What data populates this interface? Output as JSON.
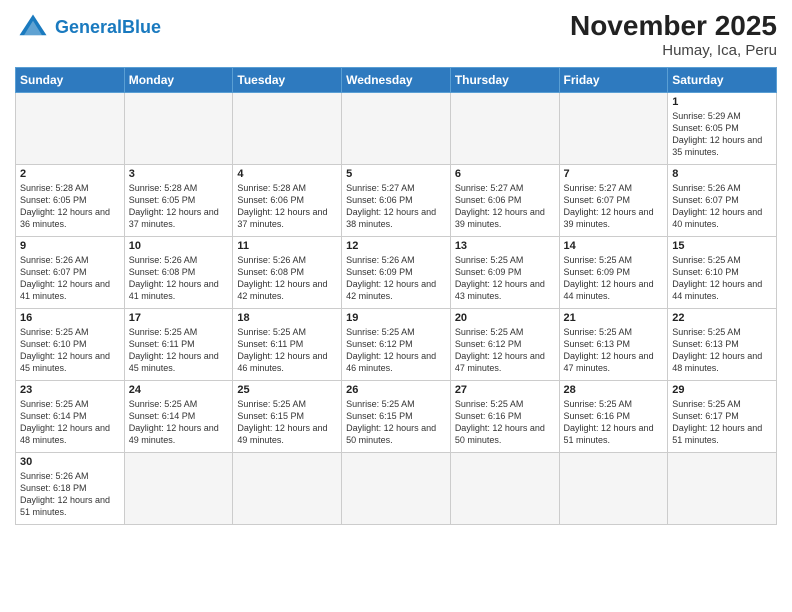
{
  "header": {
    "logo_general": "General",
    "logo_blue": "Blue",
    "title": "November 2025",
    "subtitle": "Humay, Ica, Peru"
  },
  "days_of_week": [
    "Sunday",
    "Monday",
    "Tuesday",
    "Wednesday",
    "Thursday",
    "Friday",
    "Saturday"
  ],
  "weeks": [
    [
      {
        "day": "",
        "info": "",
        "empty": true
      },
      {
        "day": "",
        "info": "",
        "empty": true
      },
      {
        "day": "",
        "info": "",
        "empty": true
      },
      {
        "day": "",
        "info": "",
        "empty": true
      },
      {
        "day": "",
        "info": "",
        "empty": true
      },
      {
        "day": "",
        "info": "",
        "empty": true
      },
      {
        "day": "1",
        "info": "Sunrise: 5:29 AM\nSunset: 6:05 PM\nDaylight: 12 hours\nand 35 minutes."
      }
    ],
    [
      {
        "day": "2",
        "info": "Sunrise: 5:28 AM\nSunset: 6:05 PM\nDaylight: 12 hours\nand 36 minutes."
      },
      {
        "day": "3",
        "info": "Sunrise: 5:28 AM\nSunset: 6:05 PM\nDaylight: 12 hours\nand 37 minutes."
      },
      {
        "day": "4",
        "info": "Sunrise: 5:28 AM\nSunset: 6:06 PM\nDaylight: 12 hours\nand 37 minutes."
      },
      {
        "day": "5",
        "info": "Sunrise: 5:27 AM\nSunset: 6:06 PM\nDaylight: 12 hours\nand 38 minutes."
      },
      {
        "day": "6",
        "info": "Sunrise: 5:27 AM\nSunset: 6:06 PM\nDaylight: 12 hours\nand 39 minutes."
      },
      {
        "day": "7",
        "info": "Sunrise: 5:27 AM\nSunset: 6:07 PM\nDaylight: 12 hours\nand 39 minutes."
      },
      {
        "day": "8",
        "info": "Sunrise: 5:26 AM\nSunset: 6:07 PM\nDaylight: 12 hours\nand 40 minutes."
      }
    ],
    [
      {
        "day": "9",
        "info": "Sunrise: 5:26 AM\nSunset: 6:07 PM\nDaylight: 12 hours\nand 41 minutes."
      },
      {
        "day": "10",
        "info": "Sunrise: 5:26 AM\nSunset: 6:08 PM\nDaylight: 12 hours\nand 41 minutes."
      },
      {
        "day": "11",
        "info": "Sunrise: 5:26 AM\nSunset: 6:08 PM\nDaylight: 12 hours\nand 42 minutes."
      },
      {
        "day": "12",
        "info": "Sunrise: 5:26 AM\nSunset: 6:09 PM\nDaylight: 12 hours\nand 42 minutes."
      },
      {
        "day": "13",
        "info": "Sunrise: 5:25 AM\nSunset: 6:09 PM\nDaylight: 12 hours\nand 43 minutes."
      },
      {
        "day": "14",
        "info": "Sunrise: 5:25 AM\nSunset: 6:09 PM\nDaylight: 12 hours\nand 44 minutes."
      },
      {
        "day": "15",
        "info": "Sunrise: 5:25 AM\nSunset: 6:10 PM\nDaylight: 12 hours\nand 44 minutes."
      }
    ],
    [
      {
        "day": "16",
        "info": "Sunrise: 5:25 AM\nSunset: 6:10 PM\nDaylight: 12 hours\nand 45 minutes."
      },
      {
        "day": "17",
        "info": "Sunrise: 5:25 AM\nSunset: 6:11 PM\nDaylight: 12 hours\nand 45 minutes."
      },
      {
        "day": "18",
        "info": "Sunrise: 5:25 AM\nSunset: 6:11 PM\nDaylight: 12 hours\nand 46 minutes."
      },
      {
        "day": "19",
        "info": "Sunrise: 5:25 AM\nSunset: 6:12 PM\nDaylight: 12 hours\nand 46 minutes."
      },
      {
        "day": "20",
        "info": "Sunrise: 5:25 AM\nSunset: 6:12 PM\nDaylight: 12 hours\nand 47 minutes."
      },
      {
        "day": "21",
        "info": "Sunrise: 5:25 AM\nSunset: 6:13 PM\nDaylight: 12 hours\nand 47 minutes."
      },
      {
        "day": "22",
        "info": "Sunrise: 5:25 AM\nSunset: 6:13 PM\nDaylight: 12 hours\nand 48 minutes."
      }
    ],
    [
      {
        "day": "23",
        "info": "Sunrise: 5:25 AM\nSunset: 6:14 PM\nDaylight: 12 hours\nand 48 minutes."
      },
      {
        "day": "24",
        "info": "Sunrise: 5:25 AM\nSunset: 6:14 PM\nDaylight: 12 hours\nand 49 minutes."
      },
      {
        "day": "25",
        "info": "Sunrise: 5:25 AM\nSunset: 6:15 PM\nDaylight: 12 hours\nand 49 minutes."
      },
      {
        "day": "26",
        "info": "Sunrise: 5:25 AM\nSunset: 6:15 PM\nDaylight: 12 hours\nand 50 minutes."
      },
      {
        "day": "27",
        "info": "Sunrise: 5:25 AM\nSunset: 6:16 PM\nDaylight: 12 hours\nand 50 minutes."
      },
      {
        "day": "28",
        "info": "Sunrise: 5:25 AM\nSunset: 6:16 PM\nDaylight: 12 hours\nand 51 minutes."
      },
      {
        "day": "29",
        "info": "Sunrise: 5:25 AM\nSunset: 6:17 PM\nDaylight: 12 hours\nand 51 minutes."
      }
    ],
    [
      {
        "day": "30",
        "info": "Sunrise: 5:26 AM\nSunset: 6:18 PM\nDaylight: 12 hours\nand 51 minutes."
      },
      {
        "day": "",
        "info": "",
        "empty": true
      },
      {
        "day": "",
        "info": "",
        "empty": true
      },
      {
        "day": "",
        "info": "",
        "empty": true
      },
      {
        "day": "",
        "info": "",
        "empty": true
      },
      {
        "day": "",
        "info": "",
        "empty": true
      },
      {
        "day": "",
        "info": "",
        "empty": true
      }
    ]
  ]
}
